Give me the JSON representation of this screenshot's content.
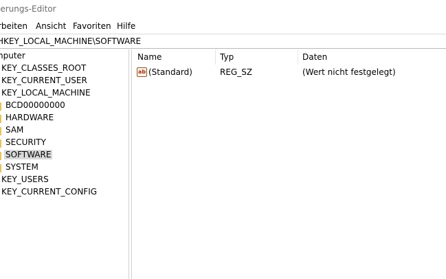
{
  "window": {
    "title": "ierungs-Editor"
  },
  "menu": {
    "items": [
      {
        "label": "rbeiten"
      },
      {
        "label": "Ansicht"
      },
      {
        "label": "Favoriten"
      },
      {
        "label": "Hilfe"
      }
    ]
  },
  "address": {
    "path": "HKEY_LOCAL_MACHINE\\SOFTWARE"
  },
  "tree": {
    "items": [
      {
        "label": "nputer"
      },
      {
        "label": "KEY_CLASSES_ROOT"
      },
      {
        "label": "KEY_CURRENT_USER"
      },
      {
        "label": "KEY_LOCAL_MACHINE"
      },
      {
        "label": "BCD00000000"
      },
      {
        "label": "HARDWARE"
      },
      {
        "label": "SAM"
      },
      {
        "label": "SECURITY"
      },
      {
        "label": "SOFTWARE",
        "selected": true
      },
      {
        "label": "SYSTEM"
      },
      {
        "label": "KEY_USERS"
      },
      {
        "label": "KEY_CURRENT_CONFIG"
      }
    ]
  },
  "list": {
    "columns": [
      "Name",
      "Typ",
      "Daten"
    ],
    "rows": [
      {
        "icon": "string-value-icon",
        "icon_text": "ab",
        "name": "(Standard)",
        "type": "REG_SZ",
        "data": "(Wert nicht festgelegt)"
      }
    ]
  },
  "colors": {
    "selection": "#d9d9d9",
    "title_text": "#6b6b6b",
    "folder": "#e8c35a"
  }
}
